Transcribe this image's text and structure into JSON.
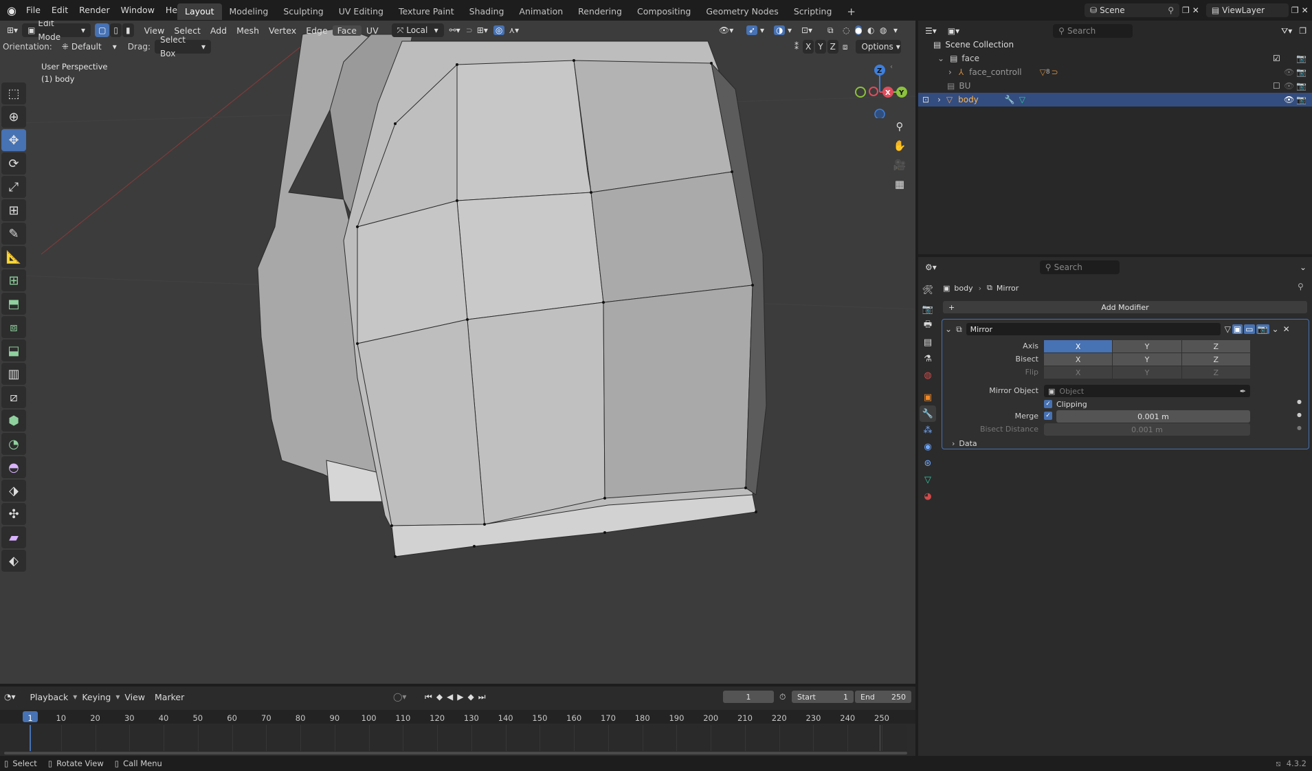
{
  "topbar": {
    "menus": [
      "File",
      "Edit",
      "Render",
      "Window",
      "Help"
    ],
    "workspaces": [
      "Layout",
      "Modeling",
      "Sculpting",
      "UV Editing",
      "Texture Paint",
      "Shading",
      "Animation",
      "Rendering",
      "Compositing",
      "Geometry Nodes",
      "Scripting"
    ],
    "active_workspace": "Layout",
    "scene": "Scene",
    "view_layer": "ViewLayer"
  },
  "viewport": {
    "mode": "Edit Mode",
    "menus": [
      "View",
      "Select",
      "Add",
      "Mesh",
      "Vertex",
      "Edge",
      "Face",
      "UV"
    ],
    "transform_orientation": "Local",
    "orientation_label": "Orientation:",
    "orientation_value": "Default",
    "drag_label": "Drag:",
    "drag_value": "Select Box",
    "perspective": "User Perspective",
    "object_info": "(1) body",
    "options": "Options",
    "axis_x": "X",
    "axis_y": "Y",
    "axis_z": "Z",
    "gizmo_x": "X",
    "gizmo_y": "Y",
    "gizmo_z": "Z"
  },
  "outliner": {
    "search_placeholder": "Search",
    "scene_collection": "Scene Collection",
    "items": [
      {
        "name": "face",
        "badge": ""
      },
      {
        "name": "face_controll",
        "badge": "8"
      },
      {
        "name": "BU",
        "badge": ""
      },
      {
        "name": "body",
        "badge": ""
      }
    ]
  },
  "properties": {
    "search_placeholder": "Search",
    "breadcrumb_object": "body",
    "breadcrumb_modifier": "Mirror",
    "add_modifier": "Add Modifier",
    "modifier_name": "Mirror",
    "axis_label": "Axis",
    "bisect_label": "Bisect",
    "flip_label": "Flip",
    "xyz": [
      "X",
      "Y",
      "Z"
    ],
    "mirror_object_label": "Mirror Object",
    "mirror_object_placeholder": "Object",
    "clipping_label": "Clipping",
    "merge_label": "Merge",
    "merge_value": "0.001 m",
    "bisect_distance_label": "Bisect Distance",
    "bisect_distance_value": "0.001 m",
    "data_label": "Data"
  },
  "timeline": {
    "menus": [
      "Playback",
      "Keying",
      "View",
      "Marker"
    ],
    "current_frame": "1",
    "start_label": "Start",
    "start_value": "1",
    "end_label": "End",
    "end_value": "250",
    "ticks": [
      "1",
      "10",
      "20",
      "30",
      "40",
      "50",
      "60",
      "70",
      "80",
      "90",
      "100",
      "110",
      "120",
      "130",
      "140",
      "150",
      "160",
      "170",
      "180",
      "190",
      "200",
      "210",
      "220",
      "230",
      "240",
      "250"
    ]
  },
  "statusbar": {
    "select": "Select",
    "rotate": "Rotate View",
    "call_menu": "Call Menu",
    "version": "4.3.2"
  },
  "colors": {
    "accent": "#4772b3",
    "selected_row": "#334d80",
    "axis_x": "#e04c5c",
    "axis_y": "#8cc23c",
    "axis_z": "#3d7fde"
  }
}
